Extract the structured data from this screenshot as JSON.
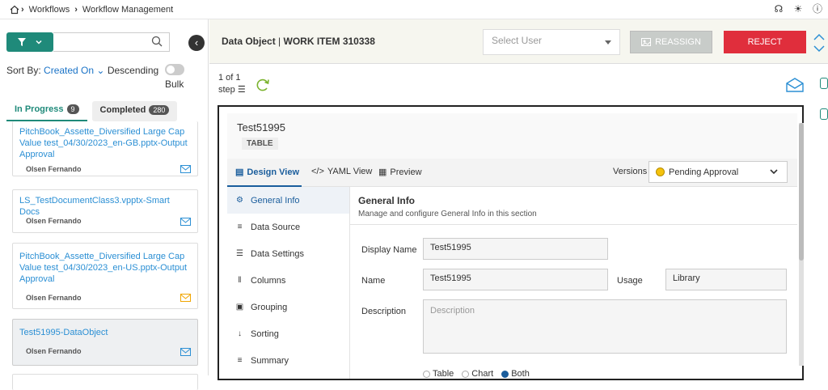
{
  "breadcrumb": {
    "items": [
      "Workflows",
      "Workflow Management"
    ]
  },
  "left": {
    "sort_label": "Sort By:",
    "sort_value": "Created On",
    "sort_order": "Descending",
    "bulk_label": "Bulk",
    "tabs": [
      {
        "label": "In Progress",
        "count": "9"
      },
      {
        "label": "Completed",
        "count": "280"
      }
    ],
    "cards": [
      {
        "title": "PitchBook_Assette_Diversified Large Cap Value test_04/30/2023_en-GB.pptx-Output Approval",
        "owner": "Olsen Fernando",
        "mail_color": "#2b8fd4"
      },
      {
        "title": "LS_TestDocumentClass3.vpptx-Smart Docs",
        "owner": "Olsen Fernando",
        "mail_color": "#2b8fd4"
      },
      {
        "title": "PitchBook_Assette_Diversified Large Cap Value test_04/30/2023_en-US.pptx-Output Approval",
        "owner": "Olsen Fernando",
        "mail_color": "#f0a500"
      },
      {
        "title": "Test51995-DataObject",
        "owner": "Olsen Fernando",
        "mail_color": "#2b8fd4"
      }
    ]
  },
  "header": {
    "object_type": "Data Object",
    "divider": "|",
    "work_item": "WORK ITEM 310338",
    "select_user_placeholder": "Select User",
    "reassign_label": "REASSIGN",
    "reject_label": "REJECT"
  },
  "step": {
    "line1": "1 of 1",
    "line2": "step"
  },
  "object": {
    "name": "Test51995",
    "type": "TABLE"
  },
  "view_tabs": [
    {
      "label": "Design View"
    },
    {
      "label": "YAML View"
    },
    {
      "label": "Preview"
    }
  ],
  "versions": {
    "label": "Versions",
    "selected": "Pending Approval"
  },
  "sidenav": [
    {
      "label": "General Info",
      "icon": "gear-icon"
    },
    {
      "label": "Data Source",
      "icon": "database-icon"
    },
    {
      "label": "Data Settings",
      "icon": "settings-icon"
    },
    {
      "label": "Columns",
      "icon": "columns-icon"
    },
    {
      "label": "Grouping",
      "icon": "grouping-icon"
    },
    {
      "label": "Sorting",
      "icon": "sort-icon"
    },
    {
      "label": "Summary",
      "icon": "summary-icon"
    }
  ],
  "general_info": {
    "title": "General Info",
    "subtitle": "Manage and configure General Info in this section",
    "display_name_label": "Display Name",
    "display_name_value": "Test51995",
    "name_label": "Name",
    "name_value": "Test51995",
    "usage_label": "Usage",
    "usage_value": "Library",
    "description_label": "Description",
    "description_placeholder": "Description",
    "radio_options": [
      "Table",
      "Chart",
      "Both"
    ],
    "radio_selected": "Both"
  },
  "colors": {
    "teal": "#1f8a7a",
    "blue": "#2b8fd4",
    "red": "#e02e3c",
    "navy": "#1a5d9c"
  }
}
